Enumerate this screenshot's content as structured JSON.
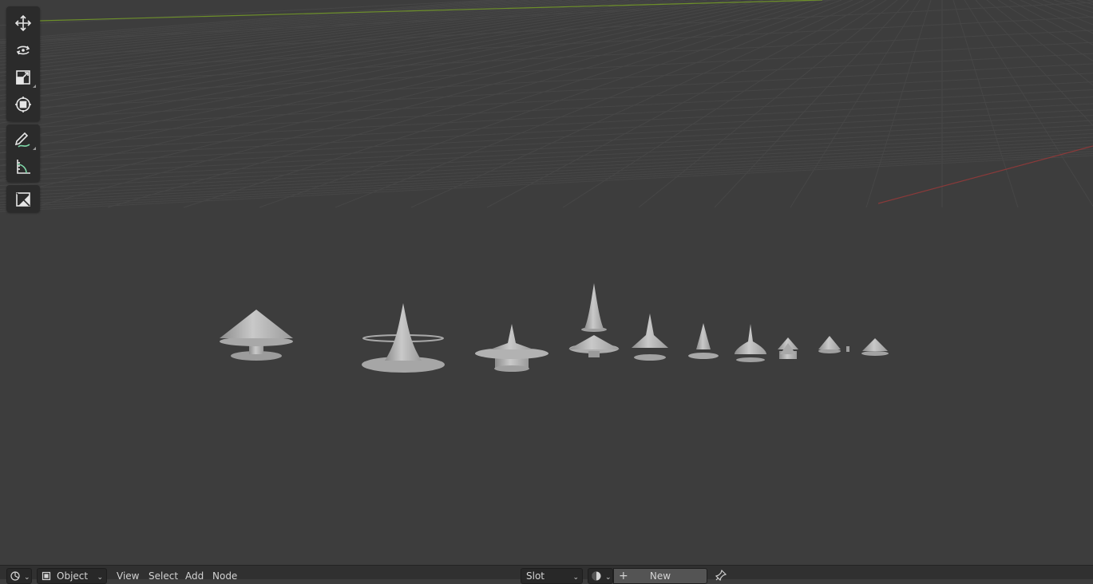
{
  "toolbar": {
    "tools": [
      {
        "name": "move-icon"
      },
      {
        "name": "rotate-icon"
      },
      {
        "name": "scale-icon"
      },
      {
        "name": "transform-icon"
      },
      {
        "name": "annotate-icon"
      },
      {
        "name": "measure-icon"
      },
      {
        "name": "add-cube-icon"
      }
    ]
  },
  "header": {
    "mode_label": "Object",
    "menus": [
      "View",
      "Select",
      "Add",
      "Node"
    ],
    "slot_label": "Slot",
    "new_label": "New"
  },
  "colors": {
    "viewport_bg": "#3d3d3d",
    "grid_line": "#4a4a4a",
    "x_axis": "#8a3a3a",
    "y_axis": "#6d8f2a",
    "model": "#b8b8b8"
  }
}
